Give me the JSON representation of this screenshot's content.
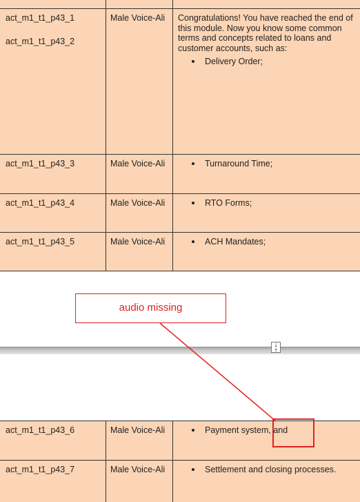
{
  "rows_top": [
    {
      "ids": [
        "act_m1_t1_p43_1",
        "act_m1_t1_p43_2"
      ],
      "voice": "Male Voice-Ali",
      "text": "Congratulations! You have reached the end of this module. Now you know some common terms and concepts related to loans and customer accounts, such as:",
      "bullet": "Delivery Order;"
    },
    {
      "ids": [
        "act_m1_t1_p43_3"
      ],
      "voice": "Male Voice-Ali",
      "bullet": "Turnaround Time;"
    },
    {
      "ids": [
        "act_m1_t1_p43_4"
      ],
      "voice": "Male Voice-Ali",
      "bullet": "RTO Forms;"
    },
    {
      "ids": [
        "act_m1_t1_p43_5"
      ],
      "voice": "Male Voice-Ali",
      "bullet": "ACH Mandates;"
    }
  ],
  "rows_bottom": [
    {
      "ids": [
        "act_m1_t1_p43_6"
      ],
      "voice": "Male Voice-Ali",
      "bullet": "Payment system, and"
    },
    {
      "ids": [
        "act_m1_t1_p43_7"
      ],
      "voice": "Male Voice-Ali",
      "bullet": "Settlement and closing processes."
    }
  ],
  "annotation": {
    "label": "audio missing",
    "color": "#e02020"
  },
  "colors": {
    "cell_background": "#fbd5b5",
    "border": "#333333"
  },
  "icons": {
    "page_break": "split-arrows-icon"
  }
}
